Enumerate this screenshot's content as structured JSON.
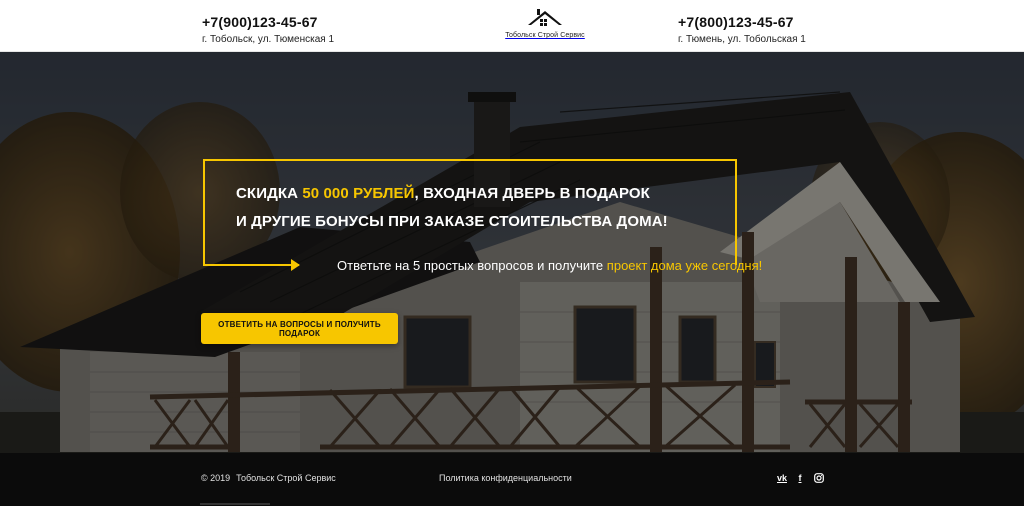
{
  "header": {
    "left_contact": {
      "phone": "+7(900)123-45-67",
      "address": "г. Тобольск, ул. Тюменская 1"
    },
    "right_contact": {
      "phone": "+7(800)123-45-67",
      "address": "г. Тюмень, ул. Тобольская 1"
    },
    "logo": {
      "icon": "house-roof-icon",
      "name": "Тобольск Строй Сервис"
    }
  },
  "hero": {
    "headline_line1_prefix": "Скидка",
    "headline_line1_accent": "50 000 рублей",
    "headline_line1_suffix": ", входная дверь в подарок",
    "headline_line2": "и другие бонусы при заказе стоительства дома!",
    "subline_prefix": "Ответьте на 5 простых вопросов и получите",
    "subline_accent": "проект дома уже сегодня!",
    "cta_label": "Ответить на вопросы и получить подарок",
    "background": "house-photo",
    "accent_color": "#f7c600"
  },
  "footer": {
    "copyright_year": "© 2019",
    "copyright_name": "Тобольск Строй Сервис",
    "privacy_link": "Политика конфиденциальности",
    "social": [
      {
        "name": "vk",
        "icon": "vk-icon",
        "glyph": "vk"
      },
      {
        "name": "facebook",
        "icon": "facebook-icon",
        "glyph": "f"
      },
      {
        "name": "instagram",
        "icon": "instagram-icon",
        "glyph": ""
      }
    ]
  }
}
